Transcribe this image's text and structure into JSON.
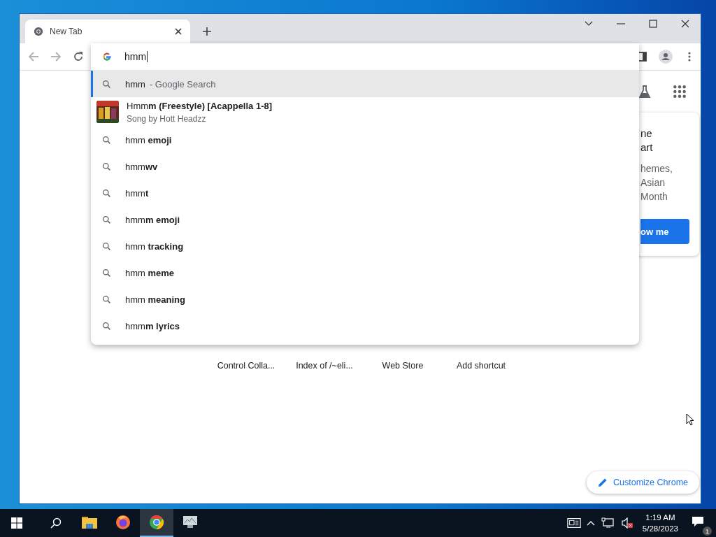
{
  "tab": {
    "title": "New Tab",
    "selected": true
  },
  "omnibox": {
    "value": "hmm"
  },
  "suggestions": [
    {
      "kind": "search",
      "text": "hmm",
      "suffix": "- Google Search",
      "selected": true
    },
    {
      "kind": "entity",
      "text": "Hmm**m (Freestyle) [Acappella 1-8]**",
      "subtitle": "Song by Hott Headzz",
      "selected": false
    },
    {
      "kind": "search",
      "text": "hmm **emoji**",
      "selected": false
    },
    {
      "kind": "search",
      "text": "hmm**wv**",
      "selected": false
    },
    {
      "kind": "search",
      "text": "hmm**t**",
      "selected": false
    },
    {
      "kind": "search",
      "text": "hmm**m emoji**",
      "selected": false
    },
    {
      "kind": "search",
      "text": "hmm **tracking**",
      "selected": false
    },
    {
      "kind": "search",
      "text": "hmm **meme**",
      "selected": false
    },
    {
      "kind": "search",
      "text": "hmm **meaning**",
      "selected": false
    },
    {
      "kind": "search",
      "text": "hmm**m lyrics**",
      "selected": false
    }
  ],
  "promo_card": {
    "title_lines": [
      "ne",
      "art"
    ],
    "body_lines": [
      "hemes,",
      "Asian",
      "Month"
    ],
    "button": "ow me"
  },
  "shortcuts": [
    "Control Colla...",
    "Index of /~eli...",
    "Web Store",
    "Add shortcut"
  ],
  "customize_button": "Customize Chrome",
  "taskbar": {
    "apps": [
      {
        "kind": "folder",
        "selected": false
      },
      {
        "kind": "firefox",
        "selected": false
      },
      {
        "kind": "chrome",
        "selected": true
      },
      {
        "kind": "monitor",
        "selected": false
      }
    ],
    "time": "1:19 AM",
    "date": "5/28/2023",
    "notification_count": "1"
  }
}
